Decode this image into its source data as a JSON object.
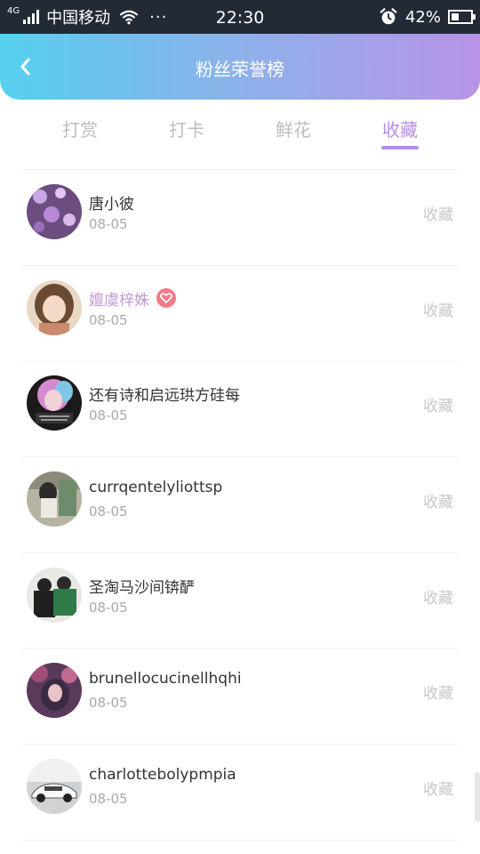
{
  "status_bar": {
    "network": "4G",
    "carrier": "中国移动",
    "dots": "···",
    "time": "22:30",
    "battery": "42%",
    "battery_level": 0.42
  },
  "header": {
    "title": "粉丝荣誉榜",
    "back_icon": "chevron-left-icon"
  },
  "tabs": [
    {
      "label": "打赏",
      "active": false
    },
    {
      "label": "打卡",
      "active": false
    },
    {
      "label": "鲜花",
      "active": false
    },
    {
      "label": "收藏",
      "active": true
    }
  ],
  "items": [
    {
      "name": "唐小彼",
      "date": "08-05",
      "action": "收藏"
    },
    {
      "name": "嬗虞梓姝",
      "date": "08-05",
      "action": "收藏",
      "badge": "heart-badge-icon"
    },
    {
      "name": "还有诗和启远珙方硅每",
      "date": "08-05",
      "action": "收藏"
    },
    {
      "name": "currqentelyliottsp",
      "date": "08-05",
      "action": "收藏"
    },
    {
      "name": "圣淘马沙间锛酽",
      "date": "08-05",
      "action": "收藏"
    },
    {
      "name": "brunellocucinellhqhi",
      "date": "08-05",
      "action": "收藏"
    },
    {
      "name": "charlottebolypmpia",
      "date": "08-05",
      "action": "收藏"
    }
  ],
  "colors": {
    "accent": "#b78ee5",
    "header_gradient_start": "#56d0ee",
    "header_gradient_end": "#b894e6",
    "status_bar": "#222a36"
  }
}
